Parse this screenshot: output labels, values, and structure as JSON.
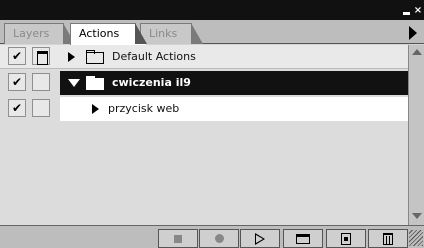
{
  "window": {
    "minimize_icon": "minimize-icon",
    "close_label": "×"
  },
  "tabs": [
    {
      "label": "Layers",
      "active": false
    },
    {
      "label": "Actions",
      "active": true
    },
    {
      "label": "Links",
      "active": false
    }
  ],
  "actions": [
    {
      "label": "Default Actions",
      "checked": true,
      "dialog_toggle": true,
      "expanded": false,
      "type": "set",
      "selected": false
    },
    {
      "label": "cwiczenia il9",
      "checked": true,
      "dialog_toggle": false,
      "expanded": true,
      "type": "set",
      "selected": true
    },
    {
      "label": "przycisk web",
      "checked": true,
      "dialog_toggle": false,
      "expanded": false,
      "type": "action",
      "selected": false
    }
  ],
  "check_glyph": "✔",
  "colors": {
    "selected_row_bg": "#111111",
    "selected_row_text": "#ffffff",
    "panel_bg": "#dcdcdc"
  },
  "bottom_buttons": [
    {
      "name": "stop-icon"
    },
    {
      "name": "record-icon"
    },
    {
      "name": "play-icon"
    },
    {
      "name": "new-set-icon"
    },
    {
      "name": "new-action-icon"
    },
    {
      "name": "trash-icon"
    }
  ]
}
